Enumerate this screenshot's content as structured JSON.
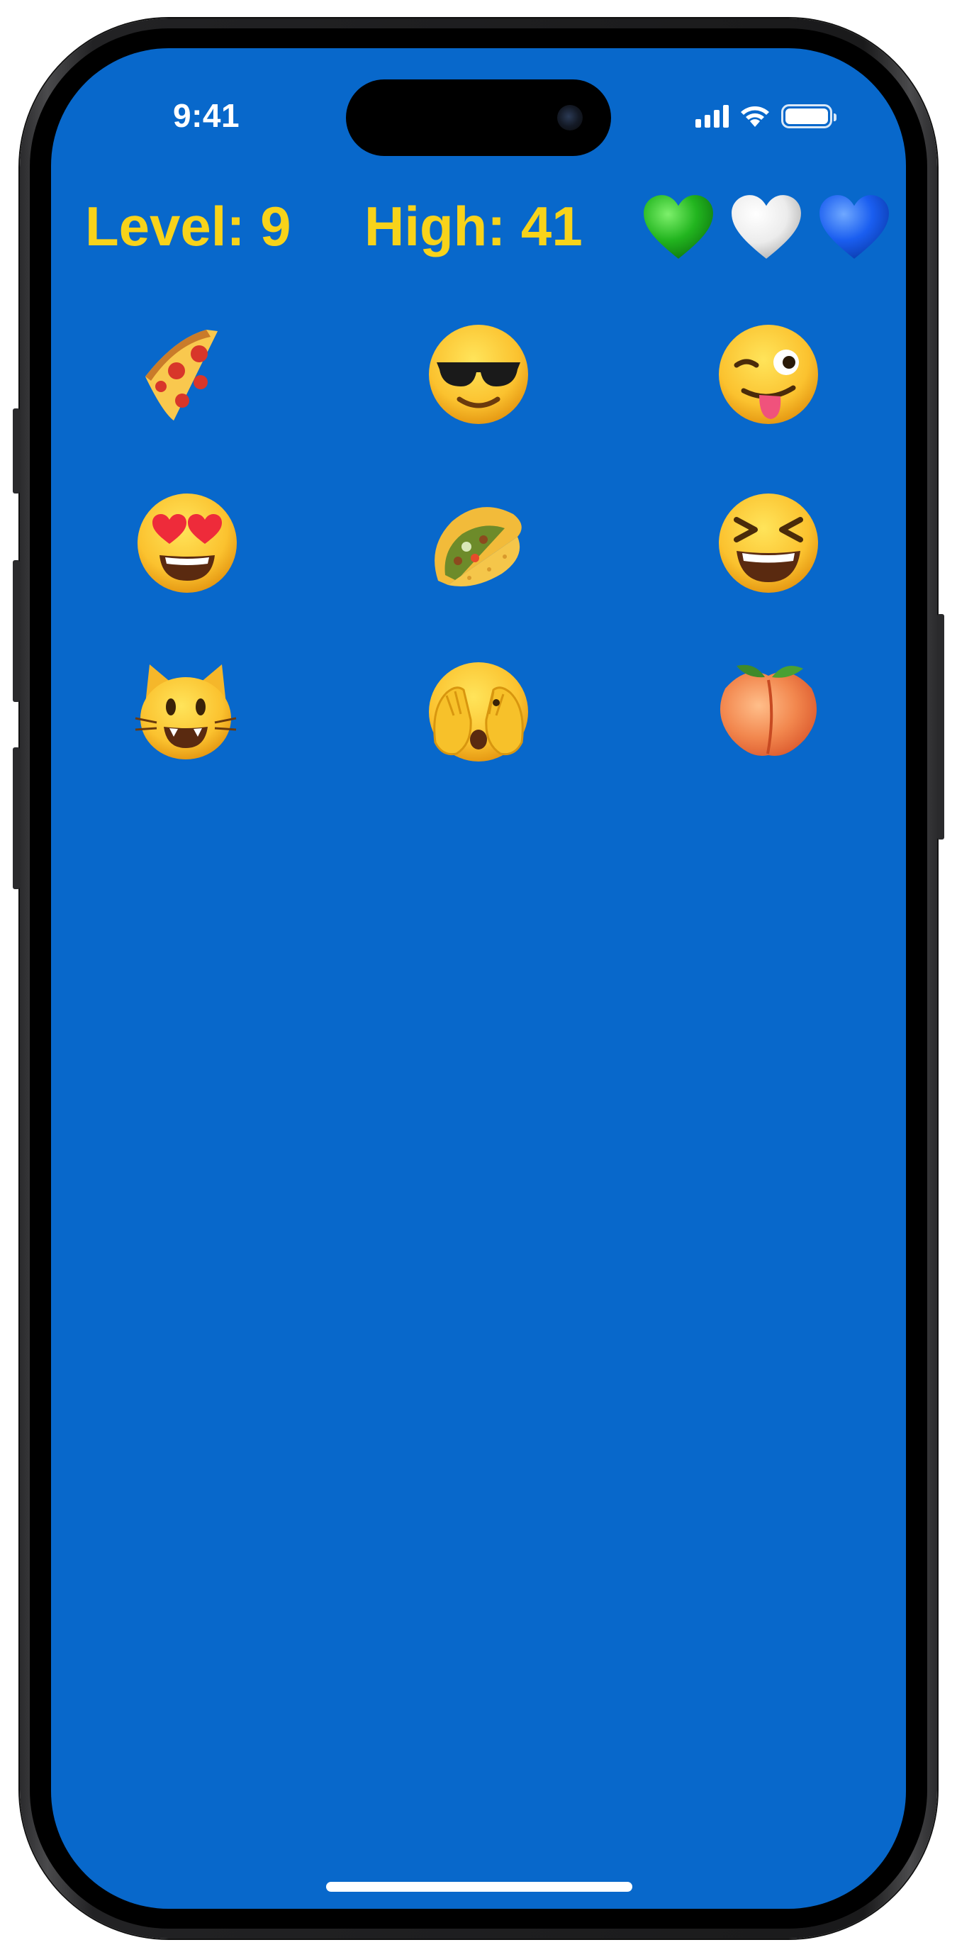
{
  "status_bar": {
    "time": "9:41",
    "icons": [
      "cellular-signal-icon",
      "wifi-icon",
      "battery-icon"
    ]
  },
  "hud": {
    "level_text": "Level: 9",
    "high_text": "High: 41",
    "text_color": "#f8d31a",
    "lives": [
      {
        "name": "green-heart-icon",
        "color": "#22b51f"
      },
      {
        "name": "white-heart-icon",
        "color": "#ececec"
      },
      {
        "name": "blue-heart-icon",
        "color": "#1a5ef0"
      }
    ]
  },
  "board": {
    "background_color": "#0868cb",
    "rows": [
      [
        "pizza",
        "smiling-face-with-sunglasses",
        "winking-face-with-tongue"
      ],
      [
        "smiling-face-with-heart-eyes",
        "taco",
        "grinning-squinting-face"
      ],
      [
        "grinning-cat",
        "face-with-hands-over-eyes",
        "peach"
      ]
    ]
  }
}
